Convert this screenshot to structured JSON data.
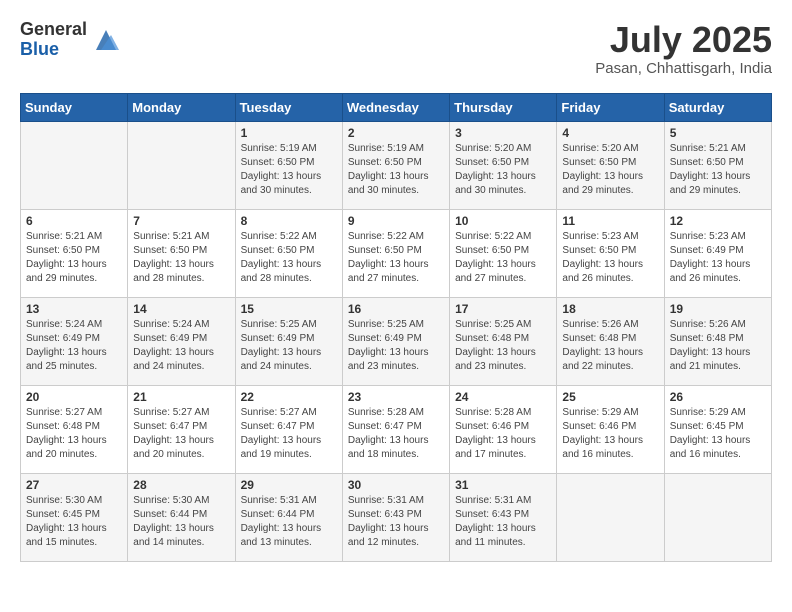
{
  "logo": {
    "general": "General",
    "blue": "Blue"
  },
  "title": {
    "month_year": "July 2025",
    "location": "Pasan, Chhattisgarh, India"
  },
  "weekdays": [
    "Sunday",
    "Monday",
    "Tuesday",
    "Wednesday",
    "Thursday",
    "Friday",
    "Saturday"
  ],
  "weeks": [
    [
      {
        "day": "",
        "info": ""
      },
      {
        "day": "",
        "info": ""
      },
      {
        "day": "1",
        "info": "Sunrise: 5:19 AM\nSunset: 6:50 PM\nDaylight: 13 hours and 30 minutes."
      },
      {
        "day": "2",
        "info": "Sunrise: 5:19 AM\nSunset: 6:50 PM\nDaylight: 13 hours and 30 minutes."
      },
      {
        "day": "3",
        "info": "Sunrise: 5:20 AM\nSunset: 6:50 PM\nDaylight: 13 hours and 30 minutes."
      },
      {
        "day": "4",
        "info": "Sunrise: 5:20 AM\nSunset: 6:50 PM\nDaylight: 13 hours and 29 minutes."
      },
      {
        "day": "5",
        "info": "Sunrise: 5:21 AM\nSunset: 6:50 PM\nDaylight: 13 hours and 29 minutes."
      }
    ],
    [
      {
        "day": "6",
        "info": "Sunrise: 5:21 AM\nSunset: 6:50 PM\nDaylight: 13 hours and 29 minutes."
      },
      {
        "day": "7",
        "info": "Sunrise: 5:21 AM\nSunset: 6:50 PM\nDaylight: 13 hours and 28 minutes."
      },
      {
        "day": "8",
        "info": "Sunrise: 5:22 AM\nSunset: 6:50 PM\nDaylight: 13 hours and 28 minutes."
      },
      {
        "day": "9",
        "info": "Sunrise: 5:22 AM\nSunset: 6:50 PM\nDaylight: 13 hours and 27 minutes."
      },
      {
        "day": "10",
        "info": "Sunrise: 5:22 AM\nSunset: 6:50 PM\nDaylight: 13 hours and 27 minutes."
      },
      {
        "day": "11",
        "info": "Sunrise: 5:23 AM\nSunset: 6:50 PM\nDaylight: 13 hours and 26 minutes."
      },
      {
        "day": "12",
        "info": "Sunrise: 5:23 AM\nSunset: 6:49 PM\nDaylight: 13 hours and 26 minutes."
      }
    ],
    [
      {
        "day": "13",
        "info": "Sunrise: 5:24 AM\nSunset: 6:49 PM\nDaylight: 13 hours and 25 minutes."
      },
      {
        "day": "14",
        "info": "Sunrise: 5:24 AM\nSunset: 6:49 PM\nDaylight: 13 hours and 24 minutes."
      },
      {
        "day": "15",
        "info": "Sunrise: 5:25 AM\nSunset: 6:49 PM\nDaylight: 13 hours and 24 minutes."
      },
      {
        "day": "16",
        "info": "Sunrise: 5:25 AM\nSunset: 6:49 PM\nDaylight: 13 hours and 23 minutes."
      },
      {
        "day": "17",
        "info": "Sunrise: 5:25 AM\nSunset: 6:48 PM\nDaylight: 13 hours and 23 minutes."
      },
      {
        "day": "18",
        "info": "Sunrise: 5:26 AM\nSunset: 6:48 PM\nDaylight: 13 hours and 22 minutes."
      },
      {
        "day": "19",
        "info": "Sunrise: 5:26 AM\nSunset: 6:48 PM\nDaylight: 13 hours and 21 minutes."
      }
    ],
    [
      {
        "day": "20",
        "info": "Sunrise: 5:27 AM\nSunset: 6:48 PM\nDaylight: 13 hours and 20 minutes."
      },
      {
        "day": "21",
        "info": "Sunrise: 5:27 AM\nSunset: 6:47 PM\nDaylight: 13 hours and 20 minutes."
      },
      {
        "day": "22",
        "info": "Sunrise: 5:27 AM\nSunset: 6:47 PM\nDaylight: 13 hours and 19 minutes."
      },
      {
        "day": "23",
        "info": "Sunrise: 5:28 AM\nSunset: 6:47 PM\nDaylight: 13 hours and 18 minutes."
      },
      {
        "day": "24",
        "info": "Sunrise: 5:28 AM\nSunset: 6:46 PM\nDaylight: 13 hours and 17 minutes."
      },
      {
        "day": "25",
        "info": "Sunrise: 5:29 AM\nSunset: 6:46 PM\nDaylight: 13 hours and 16 minutes."
      },
      {
        "day": "26",
        "info": "Sunrise: 5:29 AM\nSunset: 6:45 PM\nDaylight: 13 hours and 16 minutes."
      }
    ],
    [
      {
        "day": "27",
        "info": "Sunrise: 5:30 AM\nSunset: 6:45 PM\nDaylight: 13 hours and 15 minutes."
      },
      {
        "day": "28",
        "info": "Sunrise: 5:30 AM\nSunset: 6:44 PM\nDaylight: 13 hours and 14 minutes."
      },
      {
        "day": "29",
        "info": "Sunrise: 5:31 AM\nSunset: 6:44 PM\nDaylight: 13 hours and 13 minutes."
      },
      {
        "day": "30",
        "info": "Sunrise: 5:31 AM\nSunset: 6:43 PM\nDaylight: 13 hours and 12 minutes."
      },
      {
        "day": "31",
        "info": "Sunrise: 5:31 AM\nSunset: 6:43 PM\nDaylight: 13 hours and 11 minutes."
      },
      {
        "day": "",
        "info": ""
      },
      {
        "day": "",
        "info": ""
      }
    ]
  ]
}
